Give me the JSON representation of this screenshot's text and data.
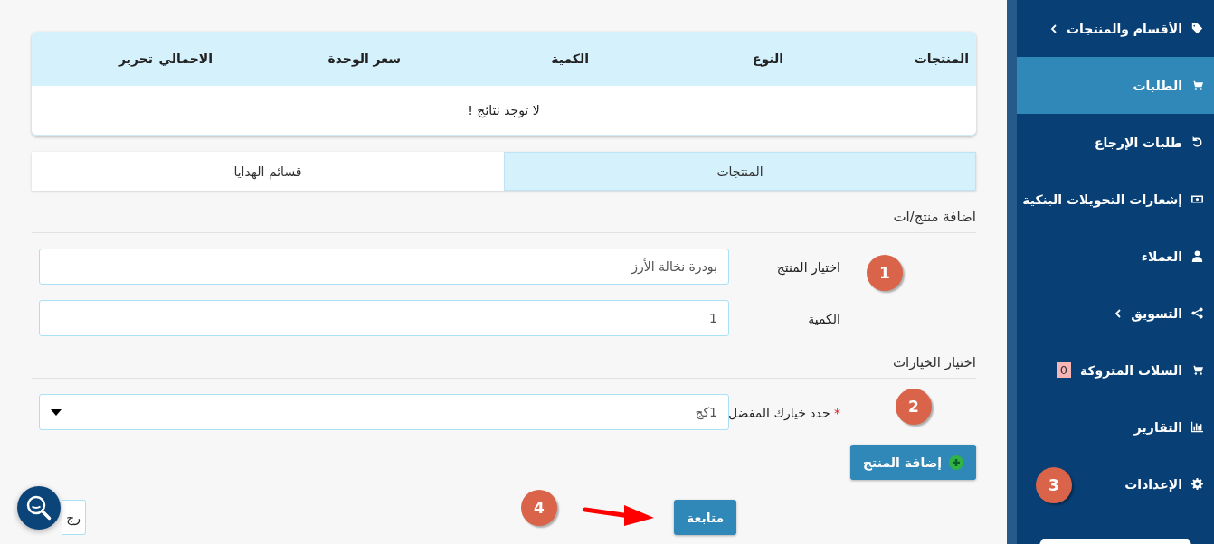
{
  "sidebar": {
    "items": [
      {
        "label": "الأقسام والمنتجات",
        "kind": "tag",
        "has_children": true,
        "selected": false
      },
      {
        "label": "الطلبات",
        "kind": "cart",
        "has_children": false,
        "selected": true
      },
      {
        "label": "طلبات الإرجاع",
        "kind": "undo",
        "has_children": false,
        "selected": false
      },
      {
        "label": "إشعارات التحويلات البنكية",
        "kind": "money",
        "has_children": false,
        "selected": false
      },
      {
        "label": "العملاء",
        "kind": "user",
        "has_children": false,
        "selected": false
      },
      {
        "label": "التسويق",
        "kind": "share",
        "has_children": true,
        "selected": false
      },
      {
        "label": "السلات المتروكة",
        "kind": "cart",
        "has_children": false,
        "selected": false,
        "badge": "0"
      },
      {
        "label": "التقارير",
        "kind": "chart",
        "has_children": false,
        "selected": false
      },
      {
        "label": "الإعدادات",
        "kind": "gear",
        "has_children": false,
        "selected": false
      }
    ]
  },
  "table": {
    "columns": [
      "المنتجات",
      "النوع",
      "الكمية",
      "سعر الوحدة",
      "الاجمالي",
      "تحرير"
    ],
    "empty_message": "لا توجد نتائج !"
  },
  "tabs": [
    {
      "label": "المنتجات",
      "selected": true
    },
    {
      "label": "قسائم الهدايا",
      "selected": false
    }
  ],
  "add_section": {
    "title": "اضافة منتج/ات",
    "fields": [
      {
        "label": "اختيار المنتج",
        "value": "بودرة نخالة الأرز"
      },
      {
        "label": "الكمية",
        "value": "1"
      }
    ]
  },
  "options_section": {
    "title": "اختيار الخيارات",
    "select": {
      "label": "حدد خيارك المفضل",
      "required_mark": "*",
      "value": "1كج"
    }
  },
  "add_button": "إضافة المنتج",
  "continue_button": "متابعة",
  "back_button": "رج",
  "annotations": [
    "1",
    "2",
    "3",
    "4"
  ]
}
